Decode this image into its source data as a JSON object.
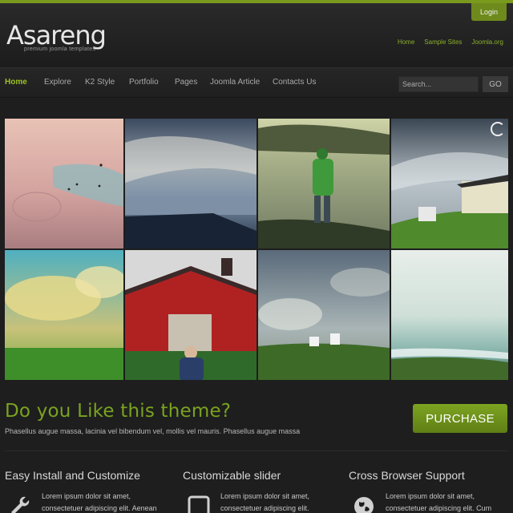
{
  "header": {
    "login_label": "Login",
    "logo": "Asareng",
    "tagline": "premium joomla templates",
    "top_links": [
      "Home",
      "Sample Sites",
      "Joomla.org"
    ]
  },
  "nav": {
    "items": [
      "Home",
      "Explore",
      "K2 Style",
      "Portfolio",
      "Pages",
      "Joomla Article",
      "Contacts Us"
    ],
    "active": "Home",
    "search_placeholder": "Search...",
    "go_label": "GO"
  },
  "cta": {
    "title": "Do you Like this theme?",
    "subtitle": "Phasellus augue massa, lacinia vel bibendum vel, mollis vel mauris. Phasellus augue massa",
    "button": "PURCHASE"
  },
  "features": [
    {
      "title": "Easy Install and Customize",
      "line1": "Lorem ipsum dolor sit amet,",
      "line2": "consectetuer adipiscing elit. Aenean",
      "icon": "wrench-icon"
    },
    {
      "title": "Customizable slider",
      "line1": "Lorem ipsum dolor sit amet,",
      "line2": "consectetuer adipiscing elit.",
      "icon": "square-icon"
    },
    {
      "title": "Cross Browser Support",
      "line1": "Lorem ipsum dolor sit amet,",
      "line2": "consectetuer adipiscing elit. Cum sociis",
      "icon": "globe-icon"
    }
  ],
  "colors": {
    "accent": "#7a9a1e",
    "link": "#8ab02a",
    "background": "#1e1e1e"
  }
}
